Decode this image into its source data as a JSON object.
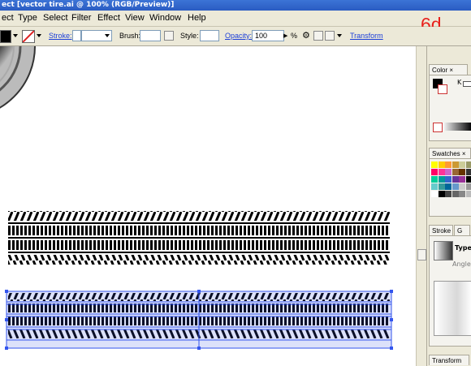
{
  "window": {
    "title": "ect [vector tire.ai @ 100% (RGB/Preview)]"
  },
  "menu": [
    "ect",
    "Type",
    "Select",
    "Filter",
    "Effect",
    "View",
    "Window",
    "Help"
  ],
  "step_label": "6d",
  "control_bar": {
    "stroke_label": "Stroke:",
    "brush_label": "Brush:",
    "style_label": "Style:",
    "opacity_label": "Opacity:",
    "opacity_value": "100",
    "percent": "%",
    "transform_label": "Transform"
  },
  "panels": {
    "color_tab": "Color",
    "color_k": "K",
    "swatches_tab": "Swatches",
    "stroke_tab": "Stroke",
    "gradient_tab": "G",
    "type_label": "Type:",
    "angle_label": "Angle:",
    "transform_tab": "Transform",
    "close_glyph": "×"
  },
  "swatch_colors": [
    [
      "#ffff00",
      "#ffcc00",
      "#ff9933",
      "#cc9933",
      "#cccc99",
      "#999966"
    ],
    [
      "#ff0066",
      "#ff3399",
      "#cc66cc",
      "#996633",
      "#663300",
      "#333333"
    ],
    [
      "#00cc99",
      "#009999",
      "#3366cc",
      "#663399",
      "#993399",
      "#000000"
    ],
    [
      "#66cccc",
      "#339999",
      "#006699",
      "#6699cc",
      "#cccccc",
      "#999999"
    ],
    [
      "#ffffff",
      "#000000",
      "#444444",
      "#666666",
      "#888888",
      "#bbbbbb"
    ]
  ]
}
